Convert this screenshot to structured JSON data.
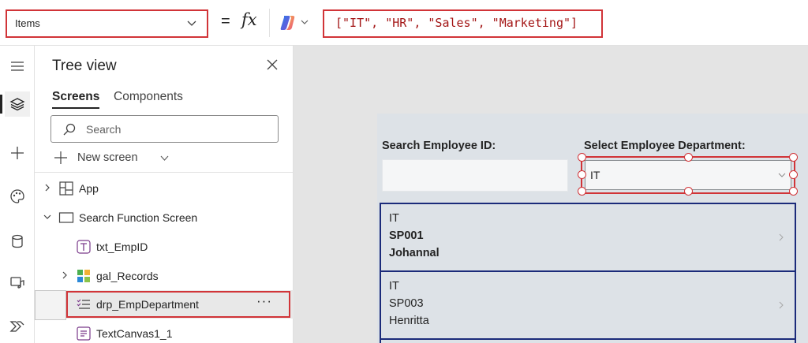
{
  "formula_bar": {
    "property": "Items",
    "equals": "=",
    "fx": "fx",
    "formula": "[\"IT\", \"HR\", \"Sales\", \"Marketing\"]"
  },
  "tree_view": {
    "title": "Tree view",
    "tabs": [
      {
        "label": "Screens",
        "active": true
      },
      {
        "label": "Components",
        "active": false
      }
    ],
    "search_placeholder": "Search",
    "new_screen_label": "New screen",
    "nodes": [
      {
        "label": "App",
        "icon": "app-icon"
      },
      {
        "label": "Search Function Screen",
        "icon": "screen-icon"
      },
      {
        "label": "txt_EmpID",
        "icon": "text-input-icon"
      },
      {
        "label": "gal_Records",
        "icon": "gallery-icon"
      },
      {
        "label": "drp_EmpDepartment",
        "icon": "dropdown-icon",
        "selected": true
      },
      {
        "label": "TextCanvas1_1",
        "icon": "text-canvas-icon"
      }
    ],
    "more_label": "···"
  },
  "canvas": {
    "search_label": "Search Employee ID:",
    "department_label": "Select Employee Department:",
    "dropdown_value": "IT",
    "gallery": [
      {
        "department": "IT",
        "id": "SP001",
        "name": "Johannal"
      },
      {
        "department": "IT",
        "id": "SP003",
        "name": "Henritta"
      }
    ]
  },
  "colors": {
    "highlight": "#d13438",
    "gallery_border": "#1b2b7a",
    "formula_text": "#a31515",
    "canvas_bg": "#e4e4e4",
    "screen_bg": "#dde2e7"
  }
}
